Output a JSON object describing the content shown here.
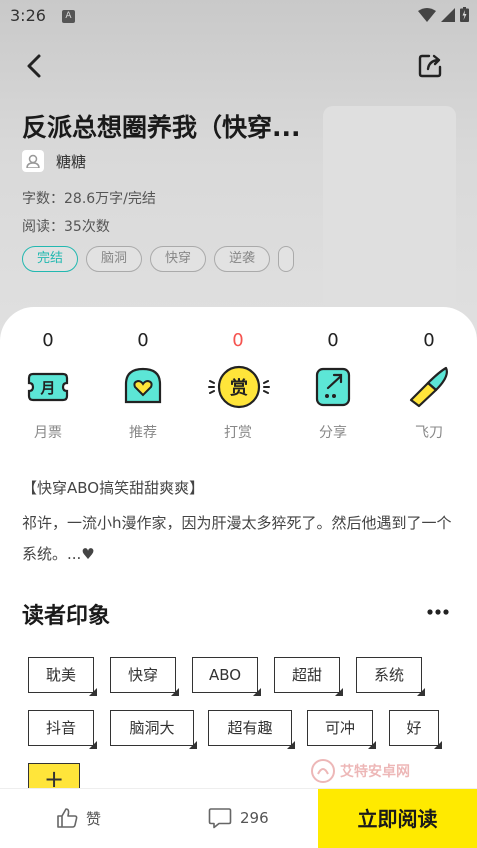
{
  "status_bar": {
    "time": "3:26",
    "badge": "A"
  },
  "book": {
    "title": "反派总想圈养我（快穿...",
    "author": "糖糖",
    "word_count": "字数：28.6万字/完结",
    "reads": "阅读：35次数",
    "tags": [
      "完结",
      "脑洞",
      "快穿",
      "逆袭"
    ]
  },
  "stats": [
    {
      "value": "0",
      "label": "月票",
      "icon": "monthly-ticket-icon"
    },
    {
      "value": "0",
      "label": "推荐",
      "icon": "heart-badge-icon"
    },
    {
      "value": "0",
      "label": "打赏",
      "icon": "reward-coin-icon",
      "glyph": "赏"
    },
    {
      "value": "0",
      "label": "分享",
      "icon": "share-box-icon"
    },
    {
      "value": "0",
      "label": "飞刀",
      "icon": "flying-knife-icon"
    }
  ],
  "monthly_glyph": "月",
  "description": {
    "headline": "【快穿ABO搞笑甜甜爽爽】",
    "body": "祁许，一流小h漫作家，因为肝漫太多猝死了。然后他遇到了一个系统。...♥"
  },
  "impressions": {
    "title": "读者印象",
    "tags": [
      "耽美",
      "快穿",
      "ABO",
      "超甜",
      "系统",
      "抖音",
      "脑洞大",
      "超有趣",
      "可冲",
      "好"
    ],
    "add_label": "+"
  },
  "bottom_bar": {
    "like_label": "赞",
    "comment_count": "296",
    "read_label": "立即阅读"
  },
  "watermark": {
    "text": "艾特安卓网"
  },
  "colors": {
    "accent_teal": "#22b8b0",
    "accent_yellow": "#ffea00",
    "reward_red": "#f5534f",
    "icon_teal": "#5ce6d6"
  }
}
